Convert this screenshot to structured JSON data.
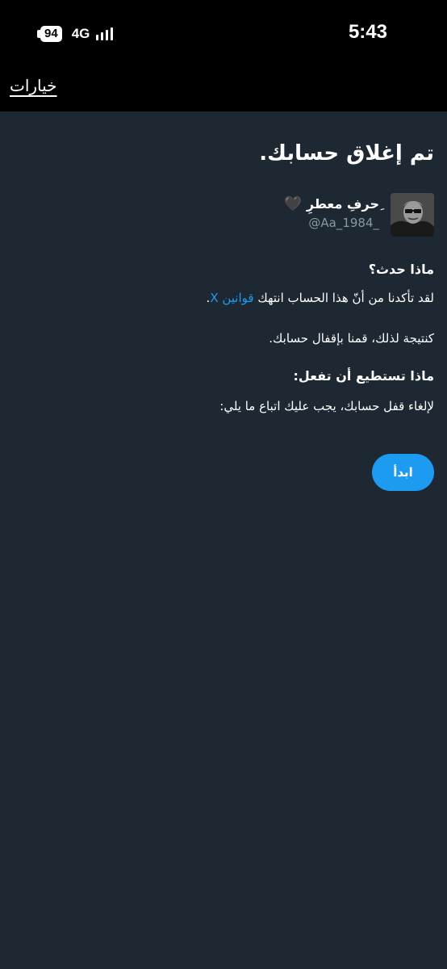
{
  "status_bar": {
    "battery": "94",
    "network": "4G",
    "time": "5:43"
  },
  "top_bar": {
    "options_link": "خيارات"
  },
  "main": {
    "heading": "تم إغلاق حسابك.",
    "profile": {
      "name": "ِحرفِ معطرِ",
      "heart": "🖤",
      "handle": "@Aa_1984_"
    },
    "what_happened": {
      "title": "ماذا حدث؟",
      "text_before_link": "لقد تأكدنا من أنّ هذا الحساب انتهك ",
      "link": "قوانين X",
      "text_after_link": "."
    },
    "result_text": "كنتيجة لذلك، قمنا بإقفال حسابك.",
    "what_can_you_do": {
      "title": "ماذا تستطيع أن تفعل:",
      "text": "لإلغاء قفل حسابك، يجب عليك اتباع ما يلي:"
    },
    "start_button": "ابدأ"
  },
  "colors": {
    "background": "#1e2833",
    "top_bar": "#000000",
    "accent": "#1d9bf0",
    "muted_text": "#8b98a5"
  },
  "icons": [
    "battery-icon",
    "signal-icon",
    "heart-icon",
    "avatar-image"
  ]
}
